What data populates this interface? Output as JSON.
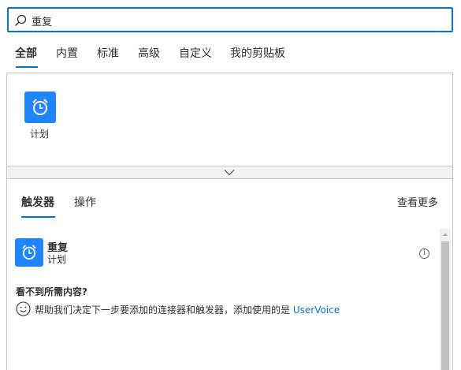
{
  "search": {
    "value": "重复",
    "icon": "search-icon"
  },
  "category_tabs": [
    {
      "label": "全部",
      "active": true
    },
    {
      "label": "内置",
      "active": false
    },
    {
      "label": "标准",
      "active": false
    },
    {
      "label": "高级",
      "active": false
    },
    {
      "label": "自定义",
      "active": false
    },
    {
      "label": "我的剪贴板",
      "active": false
    }
  ],
  "connectors": [
    {
      "label": "计划",
      "icon": "alarm-clock-icon",
      "color": "#1f85ff"
    }
  ],
  "collapse": {
    "icon": "chevron-down-icon"
  },
  "sub_tabs": [
    {
      "label": "触发器",
      "active": true
    },
    {
      "label": "操作",
      "active": false
    }
  ],
  "see_more": "查看更多",
  "actions": [
    {
      "title": "重复",
      "connector": "计划",
      "icon": "alarm-clock-icon",
      "info_icon": "info-icon"
    }
  ],
  "not_found": {
    "title": "看不到所需内容?",
    "text": "帮助我们决定下一步要添加的连接器和触发器，添加使用的是",
    "link": "UserVoice",
    "icon": "smiley-icon"
  },
  "colors": {
    "accent": "#0078d4",
    "tile": "#1f85ff"
  }
}
